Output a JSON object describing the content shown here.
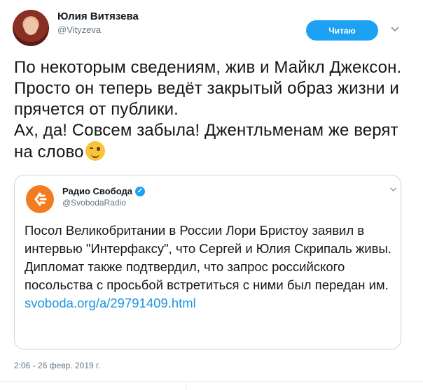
{
  "author": {
    "name": "Юлия Витязева",
    "handle": "@Vityzeva"
  },
  "follow_button": {
    "label": "Читаю"
  },
  "tweet": {
    "lines": [
      "По некоторым сведениям, жив и Майкл Джексон. Просто он теперь ведёт закрытый образ жизни и прячется от публики.",
      "Ах, да! Совсем забыла! Джентльменам же верят на слово"
    ],
    "emoji": "winking-face"
  },
  "quoted_tweet": {
    "name": "Радио Свобода",
    "handle": "@SvobodaRadio",
    "text": "Посол Великобритании в России Лори Бристоу заявил в интервью \"Интерфаксу\", что Сергей и Юлия Скрипаль живы. Дипломат также подтвердил, что запрос российского посольства с просьбой встретиться с ними был передан им.",
    "link": "svoboda.org/a/29791409.html"
  },
  "timestamp": "2:06 - 26 февр. 2019 г.",
  "colors": {
    "accent": "#1da1f2",
    "link": "#1b95e0",
    "logo": "#f47c20"
  }
}
